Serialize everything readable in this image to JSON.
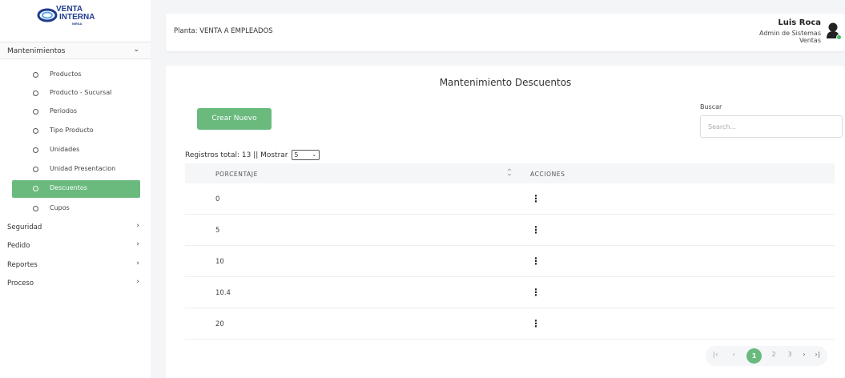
{
  "brand": {
    "line1": "VENTA",
    "line2": "INTERNA",
    "line3": "NIRSA"
  },
  "sidebar": {
    "section": {
      "label": "Mantenimientos",
      "expanded": true
    },
    "items": [
      {
        "label": "Productos",
        "active": false
      },
      {
        "label": "Producto - Sucursal",
        "active": false
      },
      {
        "label": "Periodos",
        "active": false
      },
      {
        "label": "Tipo Producto",
        "active": false
      },
      {
        "label": "Unidades",
        "active": false
      },
      {
        "label": "Unidad Presentacion",
        "active": false
      },
      {
        "label": "Descuentos",
        "active": true
      },
      {
        "label": "Cupos",
        "active": false
      }
    ],
    "groups": [
      {
        "label": "Seguridad"
      },
      {
        "label": "Pedido"
      },
      {
        "label": "Reportes"
      },
      {
        "label": "Proceso"
      }
    ]
  },
  "header": {
    "planta": "Planta: VENTA A EMPLEADOS",
    "user_name": "Luis Roca",
    "user_role_1": "Admin de Sistemas",
    "user_role_2": "Ventas"
  },
  "main": {
    "title": "Mantenimiento Descuentos",
    "create_button": "Crear Nuevo",
    "search_label": "Buscar",
    "search_placeholder": "Search...",
    "records_text": "Registros total: 13 || Mostrar",
    "page_size": "5",
    "columns": [
      "PORCENTAJE",
      "ACCIONES"
    ],
    "rows": [
      "0",
      "5",
      "10",
      "10.4",
      "20"
    ],
    "pagination": {
      "first": "⏮",
      "prev": "‹",
      "pages": [
        "1",
        "2",
        "3"
      ],
      "current": "1",
      "next": "›",
      "last": "⏭"
    }
  },
  "colors": {
    "accent": "#6aba7e",
    "brand": "#1f3b8c",
    "online": "#3fbf5f"
  }
}
